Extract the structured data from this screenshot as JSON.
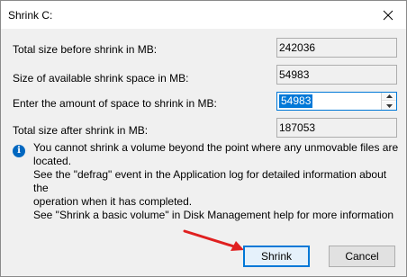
{
  "window": {
    "title": "Shrink C:"
  },
  "fields": [
    {
      "label": "Total size before shrink in MB:",
      "value": "242036"
    },
    {
      "label": "Size of available shrink space in MB:",
      "value": "54983"
    },
    {
      "label": "Enter the amount of space to shrink in MB:",
      "value": "54983"
    },
    {
      "label": "Total size after shrink in MB:",
      "value": "187053"
    }
  ],
  "info": {
    "icon": "info-icon",
    "line1": "You cannot shrink a volume beyond the point where any unmovable files are located.",
    "line2": "See the \"defrag\" event in the Application log for detailed information about the",
    "line3": "operation when it has completed."
  },
  "help_text": "See \"Shrink a basic volume\" in Disk Management help for more information",
  "buttons": {
    "shrink": "Shrink",
    "cancel": "Cancel"
  },
  "colors": {
    "accent": "#0078d7",
    "annotation_arrow": "#e02020"
  }
}
